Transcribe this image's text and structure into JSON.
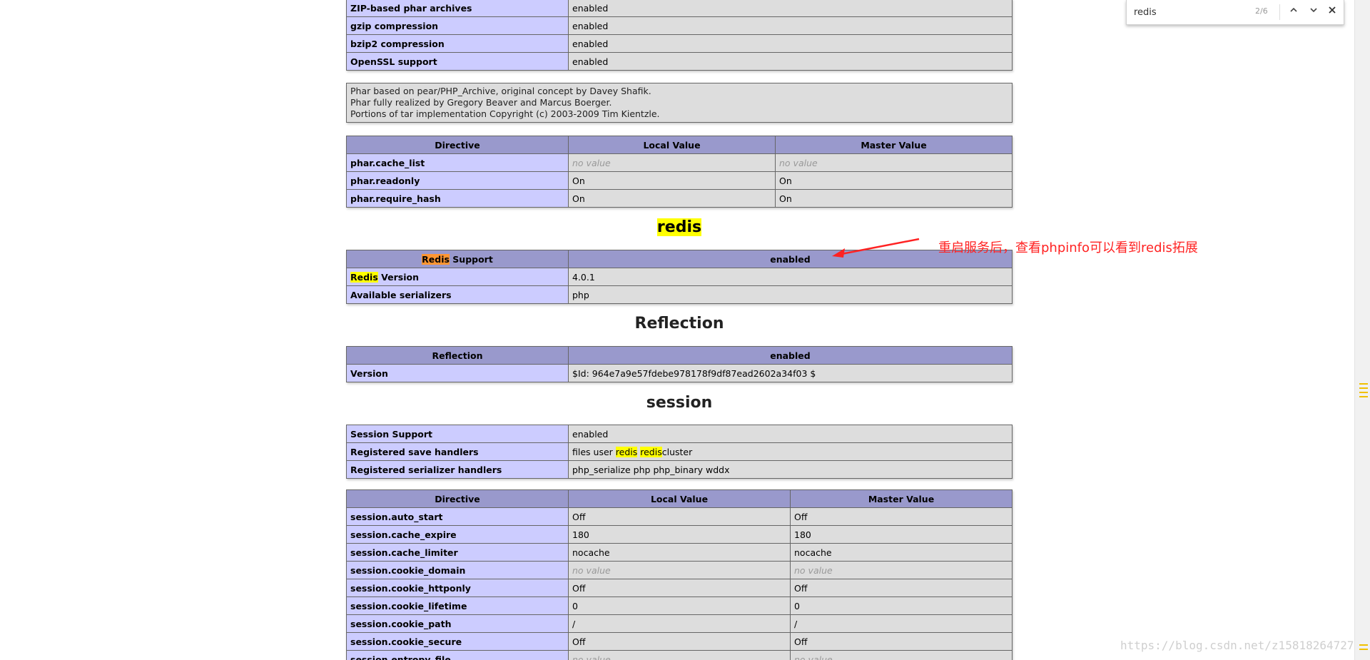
{
  "findbar": {
    "query": "redis",
    "count": "2/6"
  },
  "phar_top_rows": [
    {
      "name": "ZIP-based phar archives",
      "value": "enabled"
    },
    {
      "name": "gzip compression",
      "value": "enabled"
    },
    {
      "name": "bzip2 compression",
      "value": "enabled"
    },
    {
      "name": "OpenSSL support",
      "value": "enabled"
    }
  ],
  "phar_note": [
    "Phar based on pear/PHP_Archive, original concept by Davey Shafik.",
    "Phar fully realized by Gregory Beaver and Marcus Boerger.",
    "Portions of tar implementation Copyright (c) 2003-2009 Tim Kientzle."
  ],
  "directive_headers": {
    "directive": "Directive",
    "local": "Local Value",
    "master": "Master Value"
  },
  "phar_directives": [
    {
      "name": "phar.cache_list",
      "local": "no value",
      "master": "no value",
      "novalue": true
    },
    {
      "name": "phar.readonly",
      "local": "On",
      "master": "On",
      "novalue": false
    },
    {
      "name": "phar.require_hash",
      "local": "On",
      "master": "On",
      "novalue": false
    }
  ],
  "redis": {
    "title": "redis",
    "support_label_hl": "Redis",
    "support_label_rest": " Support",
    "support_value": "enabled",
    "version_label_hl": "Redis",
    "version_label_rest": " Version",
    "version_value": "4.0.1",
    "serializers_label": "Available serializers",
    "serializers_value": "php"
  },
  "annotation": "重启服务后，查看phpinfo可以看到redis拓展",
  "reflection": {
    "title": "Reflection",
    "header_left": "Reflection",
    "header_right": "enabled",
    "version_label": "Version",
    "version_value": "$Id: 964e7a9e57fdebe978178f9df87ead2602a34f03 $"
  },
  "session": {
    "title": "session",
    "support_label": "Session Support",
    "support_value": "enabled",
    "handlers_label": "Registered save handlers",
    "handlers_pre": "files user ",
    "handlers_hl1": "redis",
    "handlers_sp": " ",
    "handlers_hl2": "redis",
    "handlers_post": "cluster",
    "serializer_label": "Registered serializer handlers",
    "serializer_value": "php_serialize php php_binary wddx"
  },
  "session_directives": [
    {
      "name": "session.auto_start",
      "local": "Off",
      "master": "Off",
      "novalue": false
    },
    {
      "name": "session.cache_expire",
      "local": "180",
      "master": "180",
      "novalue": false
    },
    {
      "name": "session.cache_limiter",
      "local": "nocache",
      "master": "nocache",
      "novalue": false
    },
    {
      "name": "session.cookie_domain",
      "local": "no value",
      "master": "no value",
      "novalue": true
    },
    {
      "name": "session.cookie_httponly",
      "local": "Off",
      "master": "Off",
      "novalue": false
    },
    {
      "name": "session.cookie_lifetime",
      "local": "0",
      "master": "0",
      "novalue": false
    },
    {
      "name": "session.cookie_path",
      "local": "/",
      "master": "/",
      "novalue": false
    },
    {
      "name": "session.cookie_secure",
      "local": "Off",
      "master": "Off",
      "novalue": false
    },
    {
      "name": "session.entropy_file",
      "local": "no value",
      "master": "no value",
      "novalue": true
    }
  ],
  "watermark": "https://blog.csdn.net/z15818264727"
}
